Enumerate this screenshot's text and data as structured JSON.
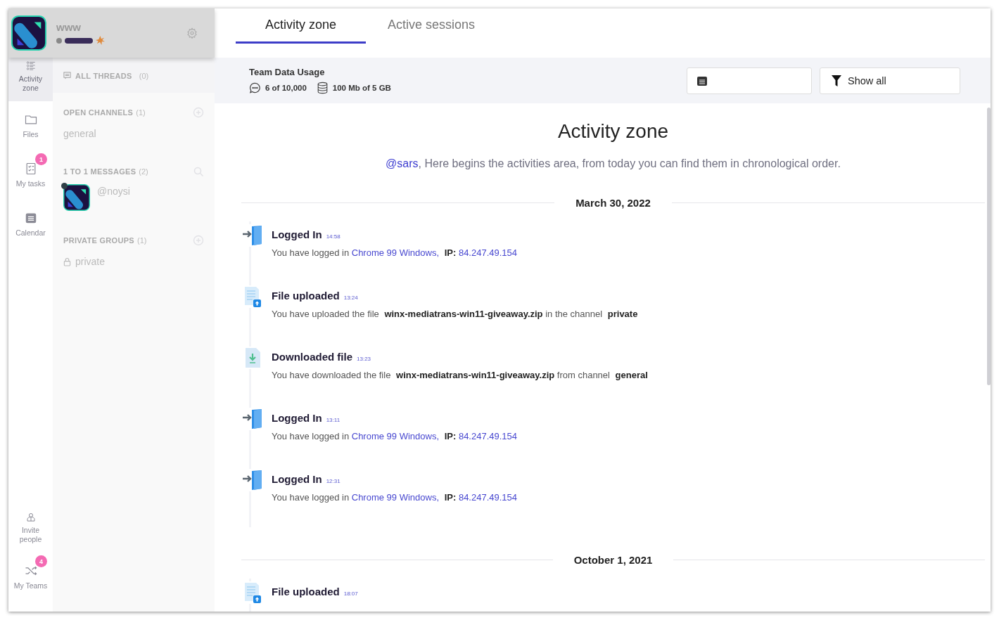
{
  "account": {
    "name": "www"
  },
  "rail": {
    "items": [
      {
        "label": "Activity zone",
        "selected": true
      },
      {
        "label": "Files",
        "selected": false
      },
      {
        "label": "My tasks",
        "selected": false,
        "badge": "1"
      },
      {
        "label": "Calendar",
        "selected": false
      }
    ],
    "bottom": [
      {
        "label": "Invite people",
        "selected": false
      },
      {
        "label": "My Teams",
        "selected": false,
        "badge": "4"
      }
    ]
  },
  "threads": {
    "label": "ALL THREADS",
    "count": "(0)"
  },
  "sections": [
    {
      "title": "OPEN CHANNELS",
      "count": "(1)",
      "items": [
        {
          "kind": "channel",
          "name": "general"
        }
      ]
    },
    {
      "title": "1 TO 1 MESSAGES",
      "count": "(2)",
      "items": [
        {
          "kind": "person",
          "name": "@noysi",
          "online": true
        }
      ]
    },
    {
      "title": "PRIVATE GROUPS",
      "count": "(1)",
      "items": [
        {
          "kind": "private",
          "name": "private"
        }
      ]
    }
  ],
  "tabs": [
    {
      "label": "Activity zone",
      "selected": true
    },
    {
      "label": "Active sessions",
      "selected": false
    }
  ],
  "usage": {
    "title": "Team Data Usage",
    "messages": "6 of 10,000",
    "storage": "100 Mb of 5 GB"
  },
  "filter": {
    "label": "Show all"
  },
  "content": {
    "heading": "Activity zone",
    "mention": "@sars",
    "intro": ", Here begins the activities area, from today you can find them in chronological order.",
    "groups": [
      {
        "date": "March 30, 2022",
        "events": [
          {
            "kind": "login",
            "title": "Logged In",
            "time": "14:58",
            "parts": [
              {
                "kind": "plain",
                "text": "You have logged in"
              },
              {
                "kind": "link",
                "text": "Chrome 99 Windows,"
              },
              {
                "kind": "bold",
                "text": "IP:"
              },
              {
                "kind": "link",
                "text": "84.247.49.154"
              }
            ]
          },
          {
            "kind": "upload",
            "title": "File uploaded",
            "time": "13:24",
            "parts": [
              {
                "kind": "plain",
                "text": "You have uploaded the file"
              },
              {
                "kind": "bold",
                "text": "winx-mediatrans-win11-giveaway.zip"
              },
              {
                "kind": "plain",
                "text": "in the channel"
              },
              {
                "kind": "bold",
                "text": "private"
              }
            ]
          },
          {
            "kind": "download",
            "title": "Downloaded file",
            "time": "13:23",
            "parts": [
              {
                "kind": "plain",
                "text": "You have downloaded the file"
              },
              {
                "kind": "bold",
                "text": "winx-mediatrans-win11-giveaway.zip"
              },
              {
                "kind": "plain",
                "text": "from channel"
              },
              {
                "kind": "bold",
                "text": "general"
              }
            ]
          },
          {
            "kind": "login",
            "title": "Logged In",
            "time": "13:11",
            "parts": [
              {
                "kind": "plain",
                "text": "You have logged in"
              },
              {
                "kind": "link",
                "text": "Chrome 99 Windows,"
              },
              {
                "kind": "bold",
                "text": "IP:"
              },
              {
                "kind": "link",
                "text": "84.247.49.154"
              }
            ]
          },
          {
            "kind": "login",
            "title": "Logged In",
            "time": "12:31",
            "parts": [
              {
                "kind": "plain",
                "text": "You have logged in"
              },
              {
                "kind": "link",
                "text": "Chrome 99 Windows,"
              },
              {
                "kind": "bold",
                "text": "IP:"
              },
              {
                "kind": "link",
                "text": "84.247.49.154"
              }
            ]
          }
        ]
      },
      {
        "date": "October 1, 2021",
        "events": [
          {
            "kind": "upload",
            "title": "File uploaded",
            "time": "18:07"
          }
        ]
      }
    ]
  }
}
